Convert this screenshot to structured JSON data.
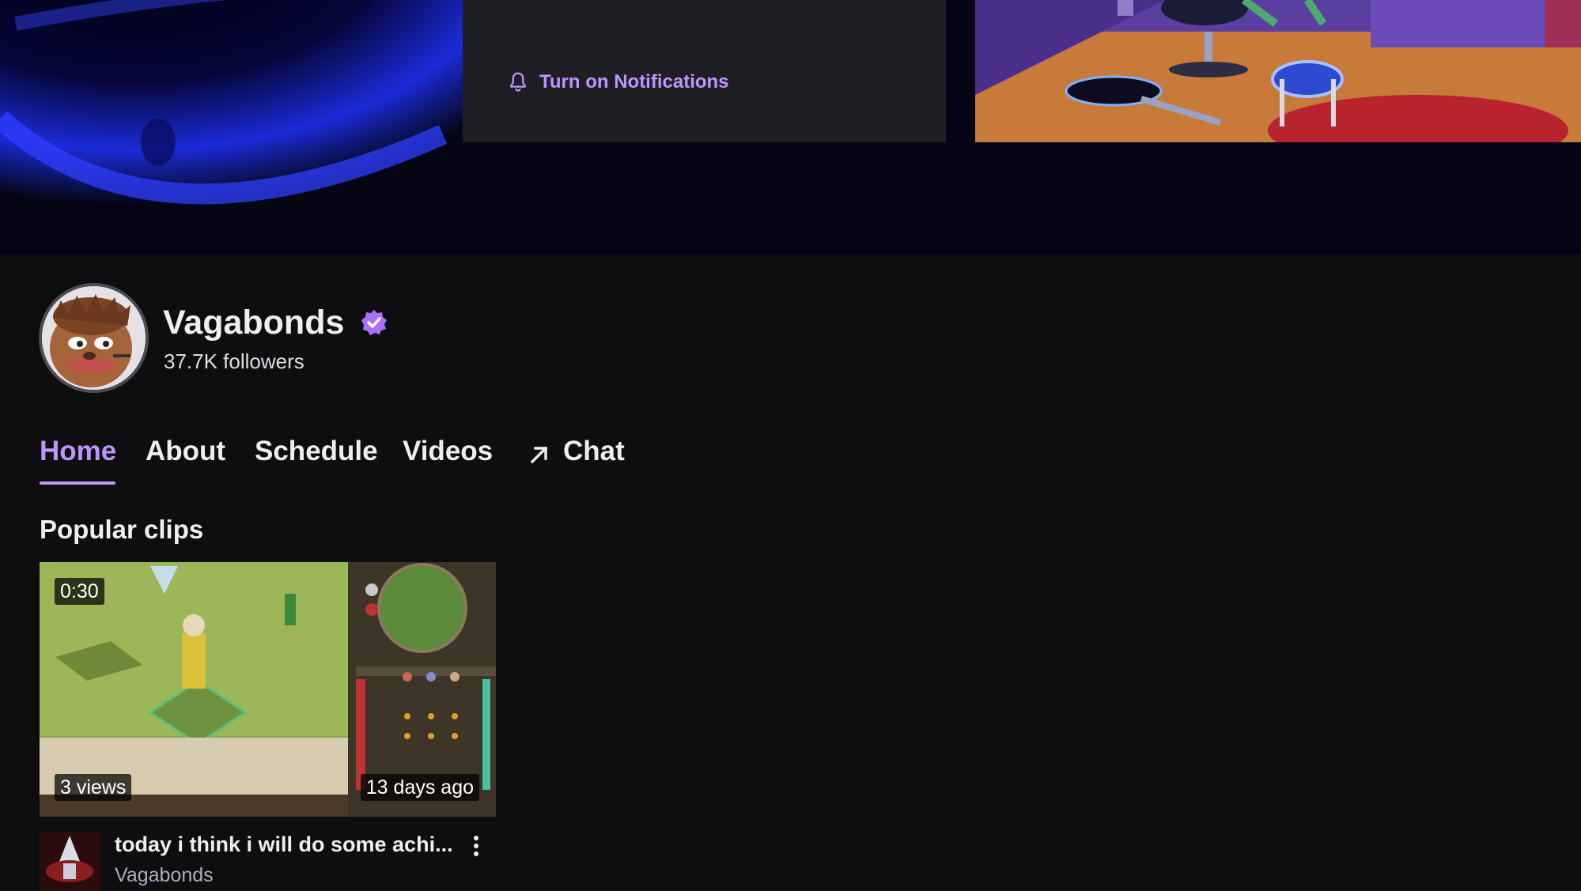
{
  "banner": {
    "notifications_label": "Turn on Notifications"
  },
  "channel": {
    "name": "Vagabonds",
    "followers": "37.7K followers",
    "verified": true
  },
  "tabs": [
    {
      "label": "Home",
      "active": true
    },
    {
      "label": "About",
      "active": false
    },
    {
      "label": "Schedule",
      "active": false
    },
    {
      "label": "Videos",
      "active": false
    },
    {
      "label": "Chat",
      "active": false,
      "icon": "external-arrow-icon"
    }
  ],
  "popular_clips": {
    "title": "Popular clips",
    "clips": [
      {
        "duration": "0:30",
        "views": "3 views",
        "age": "13 days ago",
        "title": "today i think i will do some achi...",
        "channel": "Vagabonds"
      }
    ]
  },
  "colors": {
    "accent": "#bf94ff",
    "background": "#0e0e10",
    "card": "#1f1f23"
  }
}
